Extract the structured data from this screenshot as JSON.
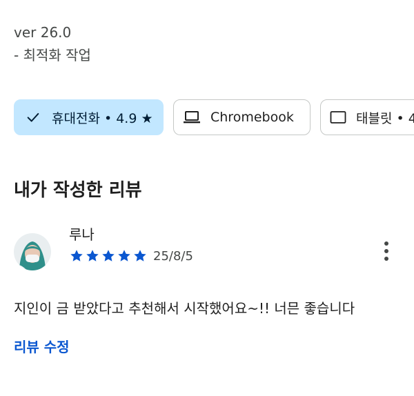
{
  "version_text": "ver 26.0",
  "changelog_item": "- 최적화 작업",
  "device_chips": [
    {
      "label": "휴대전화 • 4.9 ★",
      "selected": true,
      "icon": "check-icon"
    },
    {
      "label": "Chromebook",
      "selected": false,
      "icon": "laptop-icon"
    },
    {
      "label": "태블릿 • 4",
      "selected": false,
      "icon": "tablet-icon"
    }
  ],
  "my_review": {
    "heading": "내가 작성한 리뷰",
    "reviewer_name": "루나",
    "rating": 5,
    "date": "25/8/5",
    "text": "지인이 금 받았다고 추천해서 시작했어요~!! 너믄 좋습니다",
    "edit_label": "리뷰 수정"
  },
  "colors": {
    "accent": "#0b57d0",
    "chip_selected_bg": "#c2e7ff",
    "star": "#0b57d0"
  }
}
